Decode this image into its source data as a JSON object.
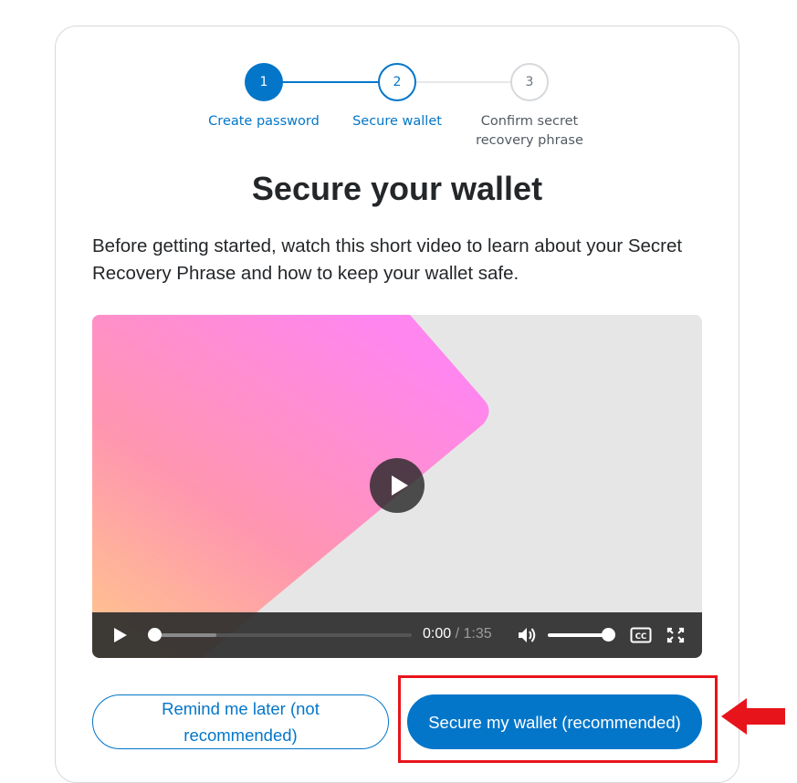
{
  "stepper": {
    "steps": [
      {
        "number": "1",
        "label": "Create password"
      },
      {
        "number": "2",
        "label": "Secure wallet"
      },
      {
        "number": "3",
        "label": "Confirm secret recovery phrase"
      }
    ],
    "active_step": 2
  },
  "title": "Secure your wallet",
  "description": "Before getting started, watch this short video to learn about your Secret Recovery Phrase and how to keep your wallet safe.",
  "video": {
    "current_time": "0:00",
    "separator": "/",
    "duration": "1:35",
    "icons": [
      "play-icon",
      "volume-icon",
      "closed-captions-icon",
      "fullscreen-icon"
    ]
  },
  "buttons": {
    "remind_later": "Remind me later (not recommended)",
    "secure_wallet": "Secure my wallet (recommended)"
  },
  "colors": {
    "primary": "#0376c9",
    "highlight": "#e8141b",
    "text": "#24272a"
  }
}
